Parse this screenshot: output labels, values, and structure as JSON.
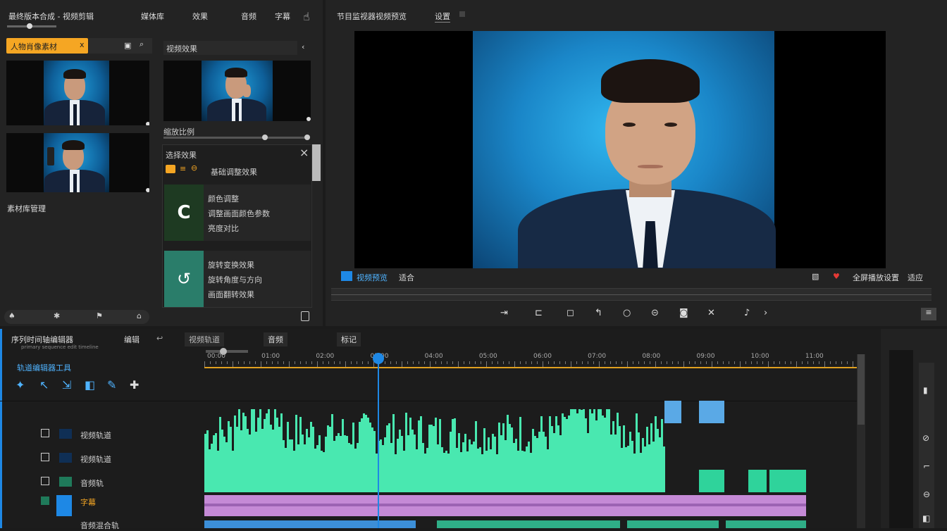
{
  "top_tabs": {
    "title": "最终版本合成 - 视频剪辑",
    "tab1": "媒体库",
    "tab2": "效果",
    "tab3": "音频",
    "tab4": "字幕"
  },
  "media": {
    "search_chip": "人物肖像素材",
    "search_chip_close": "x",
    "section_label": "素材库管理",
    "right_header": "视频效果",
    "slider_label": "缩放比例"
  },
  "effects_popup": {
    "title": "选择效果",
    "row_label": "基础调整效果",
    "close": "×",
    "card1": {
      "glyph": "C",
      "line1": "颜色调整",
      "line2": "调整画面颜色参数",
      "line3": "亮度对比"
    },
    "card2": {
      "glyph": "↺",
      "line1": "旋转变换效果",
      "line2": "旋转角度与方向",
      "line3": "画面翻转效果"
    }
  },
  "preview": {
    "title": "节目监视器视频预览",
    "tab": "设置",
    "timecode_label": "视频预览",
    "zoom_label": "适合",
    "right_label": "全屏播放设置",
    "fit_label": "适应"
  },
  "timeline": {
    "seq_title": "序列时间轴编辑器",
    "seq_sub": "primary sequence edit timeline",
    "tab1": "编辑",
    "tab2": "视频轨道",
    "tab3": "音频",
    "tab4": "标记",
    "track_tools_label": "轨道编辑器工具",
    "tracks": [
      {
        "name": "视频轨道"
      },
      {
        "name": "视频轨道"
      },
      {
        "name": "音频轨"
      },
      {
        "name": "字幕"
      },
      {
        "name": "音频混合轨"
      }
    ],
    "ruler": [
      "00:00",
      "01:00",
      "02:00",
      "03:00",
      "04:00",
      "05:00",
      "06:00",
      "07:00",
      "08:00",
      "09:00",
      "10:00",
      "11:00"
    ],
    "playhead_fraction": 0.27
  },
  "colors": {
    "accent_orange": "#f5a623",
    "accent_blue": "#1e88e5",
    "audio_green": "#2fd39b",
    "subtitle_purple": "#c58ad6"
  }
}
